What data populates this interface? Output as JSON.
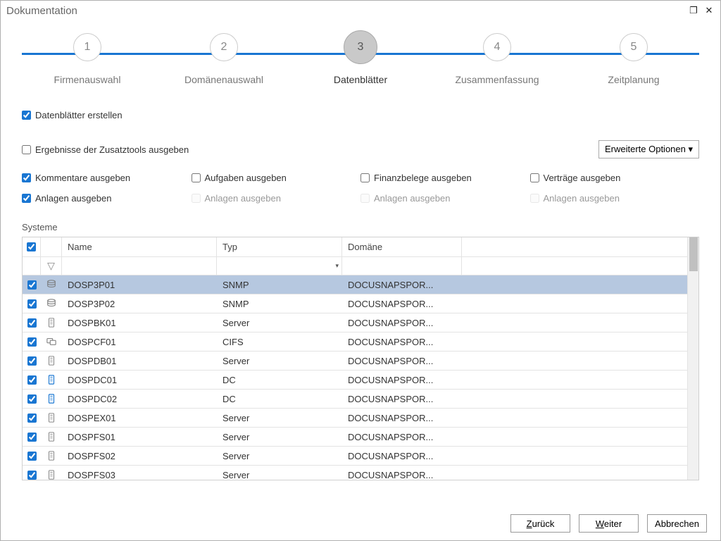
{
  "window": {
    "title": "Dokumentation"
  },
  "stepper": {
    "steps": [
      {
        "num": "1",
        "label": "Firmenauswahl"
      },
      {
        "num": "2",
        "label": "Domänenauswahl"
      },
      {
        "num": "3",
        "label": "Datenblätter"
      },
      {
        "num": "4",
        "label": "Zusammenfassung"
      },
      {
        "num": "5",
        "label": "Zeitplanung"
      }
    ],
    "active_index": 2
  },
  "master_checkbox": {
    "label": "Datenblätter erstellen",
    "checked": true
  },
  "adv_button": "Erweiterte Optionen ▾",
  "extra_tools": {
    "label": "Ergebnisse der Zusatztools ausgeben",
    "checked": false
  },
  "options": [
    {
      "label": "Kommentare ausgeben",
      "checked": true,
      "disabled": false
    },
    {
      "label": "Aufgaben ausgeben",
      "checked": false,
      "disabled": false
    },
    {
      "label": "Finanzbelege ausgeben",
      "checked": false,
      "disabled": false
    },
    {
      "label": "Verträge ausgeben",
      "checked": false,
      "disabled": false
    },
    {
      "label": "Anlagen  ausgeben",
      "checked": true,
      "disabled": false
    },
    {
      "label": "Anlagen ausgeben",
      "checked": false,
      "disabled": true
    },
    {
      "label": "Anlagen ausgeben",
      "checked": false,
      "disabled": true
    },
    {
      "label": "Anlagen ausgeben",
      "checked": false,
      "disabled": true
    }
  ],
  "section_label": "Systeme",
  "table": {
    "headers": {
      "name": "Name",
      "type": "Typ",
      "domain": "Domäne"
    },
    "rows": [
      {
        "checked": true,
        "icon": "db",
        "name": "DOSP3P01",
        "type": "SNMP",
        "domain": "DOCUSNAPSPOR...",
        "selected": true
      },
      {
        "checked": true,
        "icon": "db",
        "name": "DOSP3P02",
        "type": "SNMP",
        "domain": "DOCUSNAPSPOR...",
        "selected": false
      },
      {
        "checked": true,
        "icon": "server",
        "name": "DOSPBK01",
        "type": "Server",
        "domain": "DOCUSNAPSPOR...",
        "selected": false
      },
      {
        "checked": true,
        "icon": "cifs",
        "name": "DOSPCF01",
        "type": "CIFS",
        "domain": "DOCUSNAPSPOR...",
        "selected": false
      },
      {
        "checked": true,
        "icon": "server",
        "name": "DOSPDB01",
        "type": "Server",
        "domain": "DOCUSNAPSPOR...",
        "selected": false
      },
      {
        "checked": true,
        "icon": "dc",
        "name": "DOSPDC01",
        "type": "DC",
        "domain": "DOCUSNAPSPOR...",
        "selected": false
      },
      {
        "checked": true,
        "icon": "dc",
        "name": "DOSPDC02",
        "type": "DC",
        "domain": "DOCUSNAPSPOR...",
        "selected": false
      },
      {
        "checked": true,
        "icon": "server",
        "name": "DOSPEX01",
        "type": "Server",
        "domain": "DOCUSNAPSPOR...",
        "selected": false
      },
      {
        "checked": true,
        "icon": "server",
        "name": "DOSPFS01",
        "type": "Server",
        "domain": "DOCUSNAPSPOR...",
        "selected": false
      },
      {
        "checked": true,
        "icon": "server",
        "name": "DOSPFS02",
        "type": "Server",
        "domain": "DOCUSNAPSPOR...",
        "selected": false
      },
      {
        "checked": true,
        "icon": "server",
        "name": "DOSPFS03",
        "type": "Server",
        "domain": "DOCUSNAPSPOR...",
        "selected": false
      }
    ]
  },
  "footer": {
    "back": "Zurück",
    "next": "Weiter",
    "cancel": "Abbrechen"
  }
}
